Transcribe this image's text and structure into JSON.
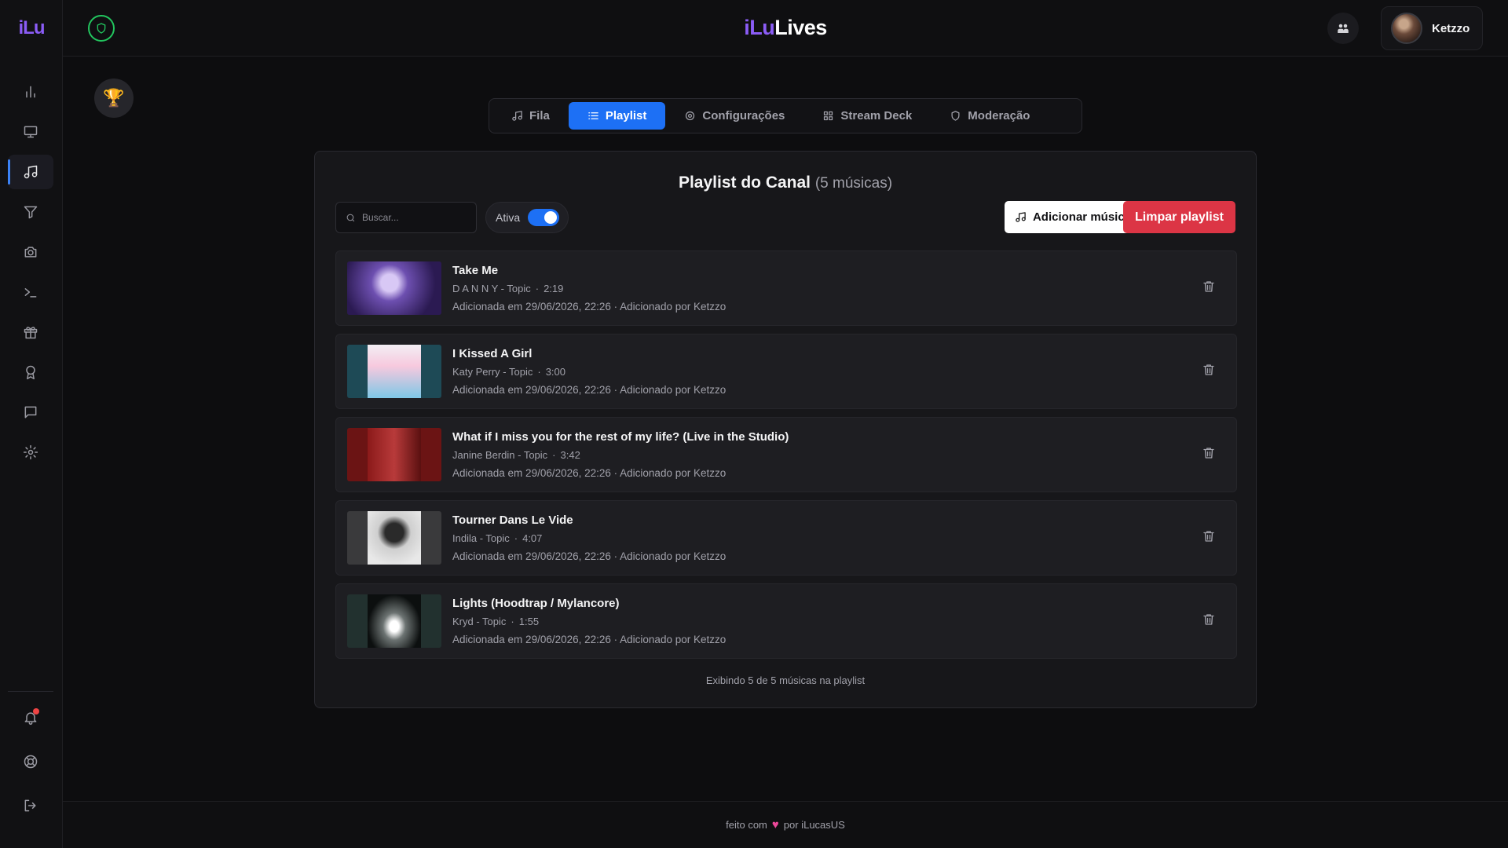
{
  "brand": {
    "logo": "iLu",
    "title_part1": "iLu",
    "title_part2": "Lives"
  },
  "user": {
    "name": "Ketzzo"
  },
  "sidebar": {
    "items": [
      {
        "icon": "chart-icon"
      },
      {
        "icon": "monitor-icon"
      },
      {
        "icon": "music-icon",
        "active": true
      },
      {
        "icon": "filter-icon"
      },
      {
        "icon": "camera-icon"
      },
      {
        "icon": "terminal-icon"
      },
      {
        "icon": "gift-icon"
      },
      {
        "icon": "award-icon"
      },
      {
        "icon": "chat-icon"
      },
      {
        "icon": "settings-icon"
      }
    ],
    "bottom": [
      {
        "icon": "bell-icon"
      },
      {
        "icon": "help-icon"
      },
      {
        "icon": "logout-icon"
      }
    ]
  },
  "tabs": [
    {
      "label": "Fila",
      "icon": "music-icon"
    },
    {
      "label": "Playlist",
      "icon": "list-icon",
      "active": true
    },
    {
      "label": "Configurações",
      "icon": "gear-icon"
    },
    {
      "label": "Stream Deck",
      "icon": "grid-icon"
    },
    {
      "label": "Moderação",
      "icon": "shield-icon"
    }
  ],
  "panel": {
    "title": "Playlist do Canal",
    "count": "(5 músicas)",
    "search_placeholder": "Buscar...",
    "toggle_label": "Ativa",
    "toggle_on": true,
    "add_button": "Adicionar música",
    "clear_button": "Limpar playlist",
    "footer": "Exibindo 5 de 5 músicas na playlist"
  },
  "songs": [
    {
      "title": "Take Me",
      "artist": "D A N N Y - Topic",
      "duration": "2:19",
      "added": "Adicionada em 29/06/2026, 22:26 · Adicionado por Ketzzo"
    },
    {
      "title": "I Kissed A Girl",
      "artist": "Katy Perry - Topic",
      "duration": "3:00",
      "added": "Adicionada em 29/06/2026, 22:26 · Adicionado por Ketzzo"
    },
    {
      "title": "What if I miss you for the rest of my life? (Live in the Studio)",
      "artist": "Janine Berdin - Topic",
      "duration": "3:42",
      "added": "Adicionada em 29/06/2026, 22:26 · Adicionado por Ketzzo"
    },
    {
      "title": "Tourner Dans Le Vide",
      "artist": "Indila - Topic",
      "duration": "4:07",
      "added": "Adicionada em 29/06/2026, 22:26 · Adicionado por Ketzzo"
    },
    {
      "title": "Lights (Hoodtrap / Mylancore)",
      "artist": "Kryd - Topic",
      "duration": "1:55",
      "added": "Adicionada em 29/06/2026, 22:26 · Adicionado por Ketzzo"
    }
  ],
  "footer": {
    "text_before": "feito com",
    "text_after": "por iLucasUS"
  },
  "colors": {
    "accent": "#1d70f5",
    "brand": "#8b5cf6",
    "danger": "#dc3545",
    "shield": "#22c55e"
  }
}
